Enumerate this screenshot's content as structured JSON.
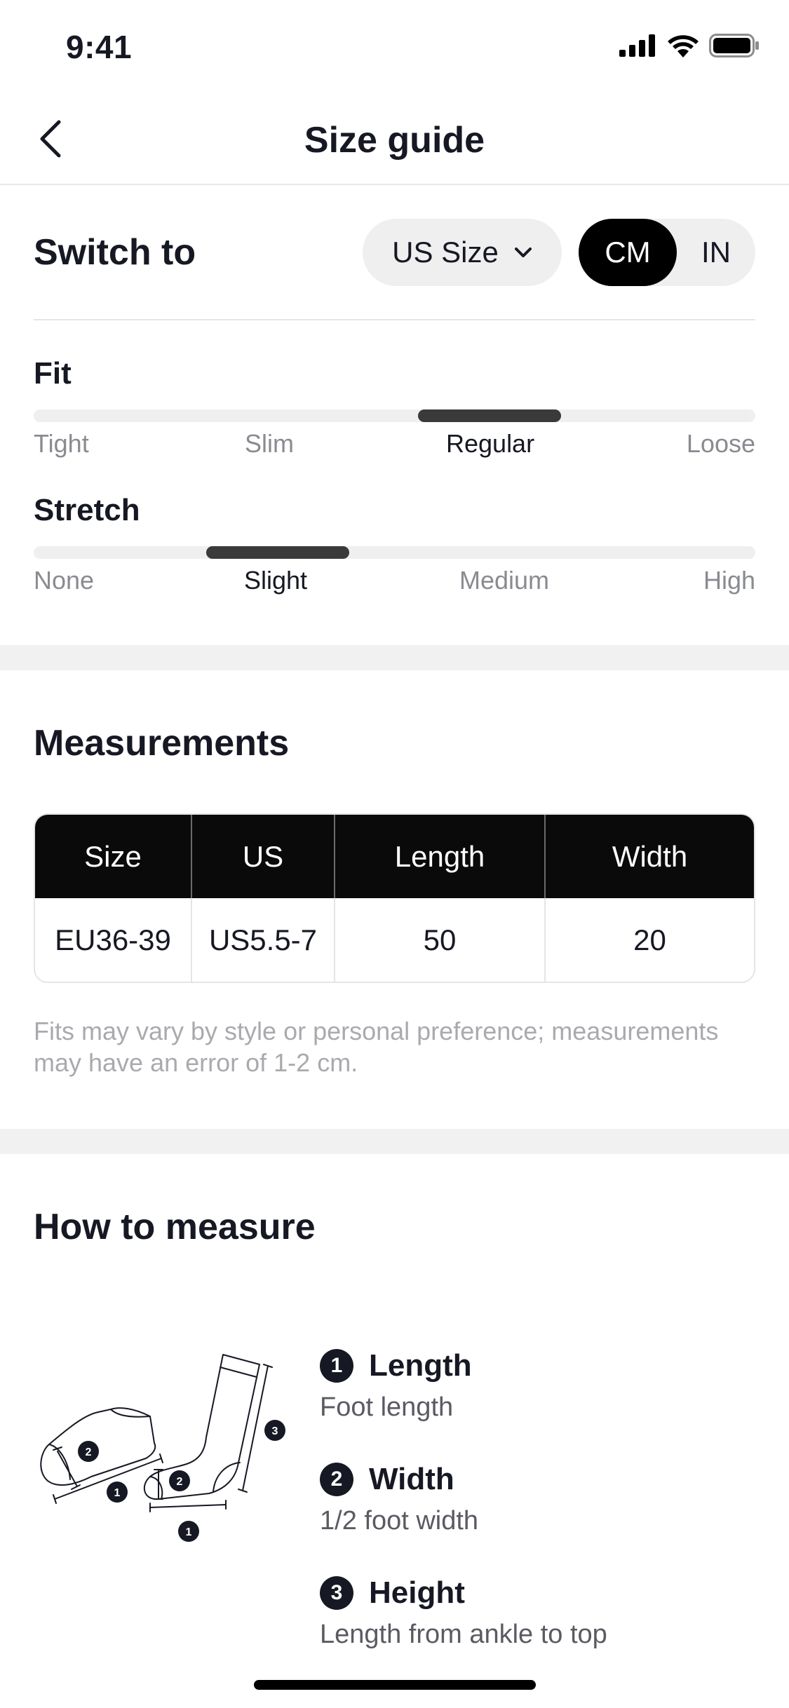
{
  "status_bar": {
    "time": "9:41"
  },
  "header": {
    "title": "Size guide"
  },
  "switch_row": {
    "label": "Switch to",
    "size_system": "US Size",
    "units": [
      {
        "label": "CM",
        "selected": true
      },
      {
        "label": "IN",
        "selected": false
      }
    ]
  },
  "fit": {
    "title": "Fit",
    "options": [
      "Tight",
      "Slim",
      "Regular",
      "Loose"
    ],
    "selected": "Regular"
  },
  "stretch": {
    "title": "Stretch",
    "options": [
      "None",
      "Slight",
      "Medium",
      "High"
    ],
    "selected": "Slight"
  },
  "measurements": {
    "title": "Measurements",
    "columns": [
      "Size",
      "US",
      "Length",
      "Width"
    ],
    "rows": [
      [
        "EU36-39",
        "US5.5-7",
        "50",
        "20"
      ]
    ],
    "note": "Fits may vary by style or personal preference; measurements may have an error of 1-2 cm."
  },
  "how_to_measure": {
    "title": "How to measure",
    "items": [
      {
        "number": "1",
        "title": "Length",
        "description": "Foot length"
      },
      {
        "number": "2",
        "title": "Width",
        "description": "1/2 foot width"
      },
      {
        "number": "3",
        "title": "Height",
        "description": "Length from ankle to top"
      }
    ]
  },
  "icons": [
    "back-chevron-icon",
    "signal-icon",
    "wifi-icon",
    "battery-icon",
    "chevron-down-icon",
    "sock-diagram-icon"
  ]
}
